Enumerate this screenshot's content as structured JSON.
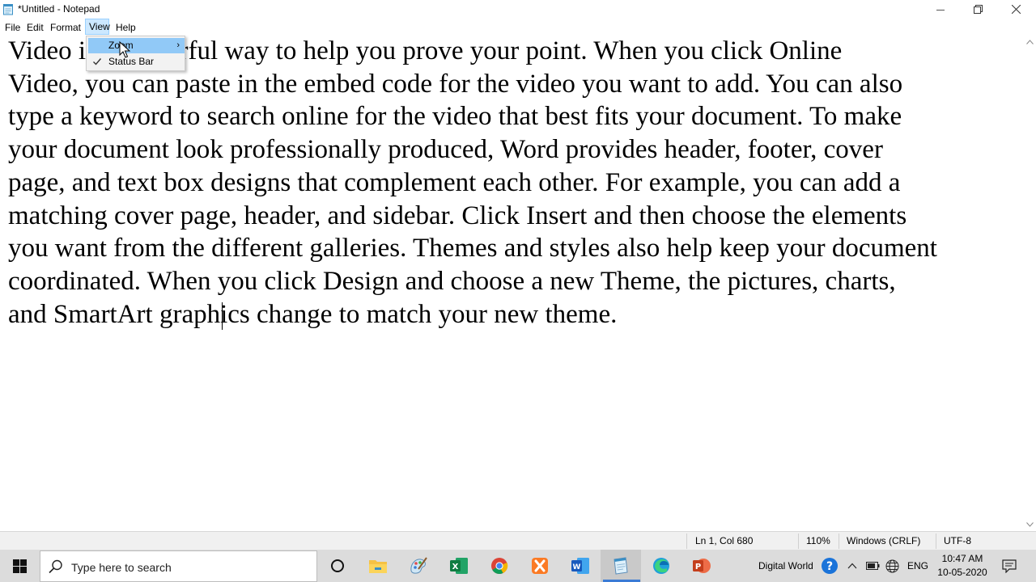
{
  "window": {
    "title": "*Untitled - Notepad"
  },
  "menubar": {
    "file": "File",
    "edit": "Edit",
    "format": "Format",
    "view": "View",
    "help": "Help"
  },
  "view_menu": {
    "items": [
      {
        "label": "Zoom",
        "has_submenu": true
      },
      {
        "label": "Status Bar",
        "checked": true
      }
    ]
  },
  "editor": {
    "lines": [
      "Video is a powerful way to help you prove your point. When you click Online",
      "Video, you can paste in the embed code for the video you want to add. You can also",
      "type a keyword to search online for the video that best fits your document. To make",
      "your document look professionally produced, Word provides header, footer, cover",
      "page, and text box designs that complement each other. For example, you can add a",
      "matching cover page, header, and sidebar. Click Insert and then choose the elements",
      "you want from the different galleries. Themes and styles also help keep your document",
      "coordinated. When you click Design and choose a new Theme, the pictures, charts,",
      "and SmartArt graphics change to match your new theme."
    ]
  },
  "statusbar": {
    "position": "Ln 1, Col 680",
    "zoom": "110%",
    "line_ending": "Windows (CRLF)",
    "encoding": "UTF-8"
  },
  "taskbar": {
    "search_placeholder": "Type here to search",
    "apps": [
      "cortana-icon",
      "file-explorer-icon",
      "paint-icon",
      "excel-icon",
      "chrome-icon",
      "xampp-icon",
      "word-icon",
      "notepad-icon",
      "edge-icon",
      "powerpoint-icon"
    ],
    "tray_label": "Digital World",
    "language": "ENG",
    "time": "10:47 AM",
    "date": "10-05-2020"
  },
  "colors": {
    "menu_highlight": "#cce8ff",
    "dropdown_highlight": "#91c9f7",
    "taskbar": "#dcdcdc",
    "statusbar": "#f0f0f0"
  }
}
